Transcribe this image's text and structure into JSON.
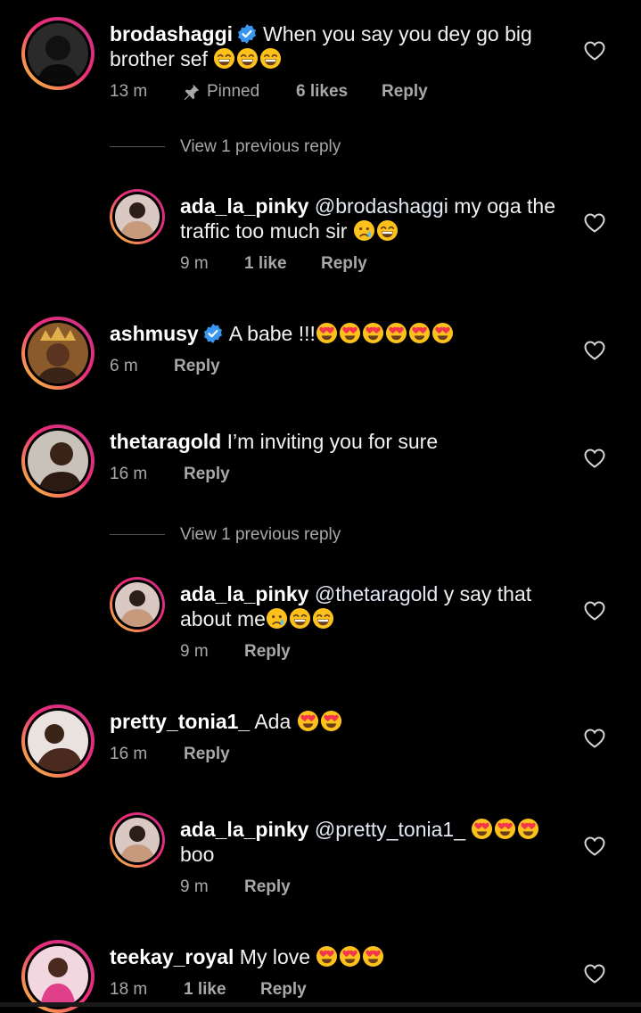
{
  "comments": [
    {
      "username": "brodashaggi",
      "verified": true,
      "text_before": "When you say you dey go big brother sef",
      "emojis": [
        "grin",
        "grin",
        "grin"
      ],
      "time": "13 m",
      "pinned_label": "Pinned",
      "likes": "6 likes",
      "reply_label": "Reply"
    },
    {
      "view_replies": "View 1 previous reply",
      "username": "ada_la_pinky",
      "mention": "@brodashaggi",
      "text": "my oga the traffic too much sir",
      "emojis": [
        "cry",
        "grin"
      ],
      "time": "9 m",
      "likes": "1 like",
      "reply_label": "Reply"
    },
    {
      "username": "ashmusy",
      "verified": true,
      "text": "A babe !!!",
      "emojis": [
        "heart-eyes",
        "heart-eyes",
        "heart-eyes",
        "heart-eyes",
        "heart-eyes",
        "heart-eyes"
      ],
      "time": "6 m",
      "reply_label": "Reply"
    },
    {
      "username": "thetaragold",
      "text": "I’m inviting you for sure",
      "time": "16 m",
      "reply_label": "Reply"
    },
    {
      "view_replies": "View 1 previous reply",
      "username": "ada_la_pinky",
      "mention": "@thetaragold",
      "text": "y say that about me",
      "emojis": [
        "cry",
        "grin",
        "grin"
      ],
      "time": "9 m",
      "reply_label": "Reply"
    },
    {
      "username": "pretty_tonia1_",
      "text": "Ada",
      "emojis": [
        "heart-eyes",
        "heart-eyes"
      ],
      "time": "16 m",
      "reply_label": "Reply"
    },
    {
      "username": "ada_la_pinky",
      "mention": "@pretty_tonia1_",
      "emojis": [
        "heart-eyes",
        "heart-eyes",
        "heart-eyes"
      ],
      "text_after": "boo",
      "time": "9 m",
      "reply_label": "Reply"
    },
    {
      "username": "teekay_royal",
      "text": "My love",
      "emojis": [
        "heart-eyes",
        "heart-eyes",
        "heart-eyes"
      ],
      "time": "18 m",
      "likes": "1 like",
      "reply_label": "Reply"
    }
  ],
  "icons": {
    "verified": "verified-badge-icon",
    "pin": "pin-icon",
    "like": "heart-outline-icon"
  },
  "colors": {
    "background": "#000000",
    "verified": "#3897f0",
    "meta": "#a8a8a8"
  }
}
